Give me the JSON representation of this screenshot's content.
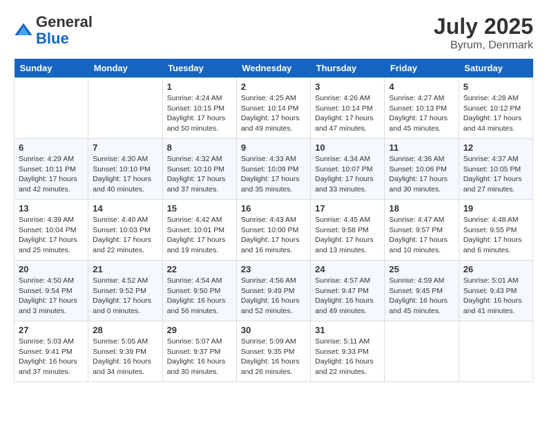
{
  "header": {
    "logo_general": "General",
    "logo_blue": "Blue",
    "month_title": "July 2025",
    "location": "Byrum, Denmark"
  },
  "days_of_week": [
    "Sunday",
    "Monday",
    "Tuesday",
    "Wednesday",
    "Thursday",
    "Friday",
    "Saturday"
  ],
  "weeks": [
    [
      {
        "day": "",
        "info": ""
      },
      {
        "day": "",
        "info": ""
      },
      {
        "day": "1",
        "info": "Sunrise: 4:24 AM\nSunset: 10:15 PM\nDaylight: 17 hours\nand 50 minutes."
      },
      {
        "day": "2",
        "info": "Sunrise: 4:25 AM\nSunset: 10:14 PM\nDaylight: 17 hours\nand 49 minutes."
      },
      {
        "day": "3",
        "info": "Sunrise: 4:26 AM\nSunset: 10:14 PM\nDaylight: 17 hours\nand 47 minutes."
      },
      {
        "day": "4",
        "info": "Sunrise: 4:27 AM\nSunset: 10:13 PM\nDaylight: 17 hours\nand 45 minutes."
      },
      {
        "day": "5",
        "info": "Sunrise: 4:28 AM\nSunset: 10:12 PM\nDaylight: 17 hours\nand 44 minutes."
      }
    ],
    [
      {
        "day": "6",
        "info": "Sunrise: 4:29 AM\nSunset: 10:11 PM\nDaylight: 17 hours\nand 42 minutes."
      },
      {
        "day": "7",
        "info": "Sunrise: 4:30 AM\nSunset: 10:10 PM\nDaylight: 17 hours\nand 40 minutes."
      },
      {
        "day": "8",
        "info": "Sunrise: 4:32 AM\nSunset: 10:10 PM\nDaylight: 17 hours\nand 37 minutes."
      },
      {
        "day": "9",
        "info": "Sunrise: 4:33 AM\nSunset: 10:09 PM\nDaylight: 17 hours\nand 35 minutes."
      },
      {
        "day": "10",
        "info": "Sunrise: 4:34 AM\nSunset: 10:07 PM\nDaylight: 17 hours\nand 33 minutes."
      },
      {
        "day": "11",
        "info": "Sunrise: 4:36 AM\nSunset: 10:06 PM\nDaylight: 17 hours\nand 30 minutes."
      },
      {
        "day": "12",
        "info": "Sunrise: 4:37 AM\nSunset: 10:05 PM\nDaylight: 17 hours\nand 27 minutes."
      }
    ],
    [
      {
        "day": "13",
        "info": "Sunrise: 4:39 AM\nSunset: 10:04 PM\nDaylight: 17 hours\nand 25 minutes."
      },
      {
        "day": "14",
        "info": "Sunrise: 4:40 AM\nSunset: 10:03 PM\nDaylight: 17 hours\nand 22 minutes."
      },
      {
        "day": "15",
        "info": "Sunrise: 4:42 AM\nSunset: 10:01 PM\nDaylight: 17 hours\nand 19 minutes."
      },
      {
        "day": "16",
        "info": "Sunrise: 4:43 AM\nSunset: 10:00 PM\nDaylight: 17 hours\nand 16 minutes."
      },
      {
        "day": "17",
        "info": "Sunrise: 4:45 AM\nSunset: 9:58 PM\nDaylight: 17 hours\nand 13 minutes."
      },
      {
        "day": "18",
        "info": "Sunrise: 4:47 AM\nSunset: 9:57 PM\nDaylight: 17 hours\nand 10 minutes."
      },
      {
        "day": "19",
        "info": "Sunrise: 4:48 AM\nSunset: 9:55 PM\nDaylight: 17 hours\nand 6 minutes."
      }
    ],
    [
      {
        "day": "20",
        "info": "Sunrise: 4:50 AM\nSunset: 9:54 PM\nDaylight: 17 hours\nand 3 minutes."
      },
      {
        "day": "21",
        "info": "Sunrise: 4:52 AM\nSunset: 9:52 PM\nDaylight: 17 hours\nand 0 minutes."
      },
      {
        "day": "22",
        "info": "Sunrise: 4:54 AM\nSunset: 9:50 PM\nDaylight: 16 hours\nand 56 minutes."
      },
      {
        "day": "23",
        "info": "Sunrise: 4:56 AM\nSunset: 9:49 PM\nDaylight: 16 hours\nand 52 minutes."
      },
      {
        "day": "24",
        "info": "Sunrise: 4:57 AM\nSunset: 9:47 PM\nDaylight: 16 hours\nand 49 minutes."
      },
      {
        "day": "25",
        "info": "Sunrise: 4:59 AM\nSunset: 9:45 PM\nDaylight: 16 hours\nand 45 minutes."
      },
      {
        "day": "26",
        "info": "Sunrise: 5:01 AM\nSunset: 9:43 PM\nDaylight: 16 hours\nand 41 minutes."
      }
    ],
    [
      {
        "day": "27",
        "info": "Sunrise: 5:03 AM\nSunset: 9:41 PM\nDaylight: 16 hours\nand 37 minutes."
      },
      {
        "day": "28",
        "info": "Sunrise: 5:05 AM\nSunset: 9:39 PM\nDaylight: 16 hours\nand 34 minutes."
      },
      {
        "day": "29",
        "info": "Sunrise: 5:07 AM\nSunset: 9:37 PM\nDaylight: 16 hours\nand 30 minutes."
      },
      {
        "day": "30",
        "info": "Sunrise: 5:09 AM\nSunset: 9:35 PM\nDaylight: 16 hours\nand 26 minutes."
      },
      {
        "day": "31",
        "info": "Sunrise: 5:11 AM\nSunset: 9:33 PM\nDaylight: 16 hours\nand 22 minutes."
      },
      {
        "day": "",
        "info": ""
      },
      {
        "day": "",
        "info": ""
      }
    ]
  ]
}
